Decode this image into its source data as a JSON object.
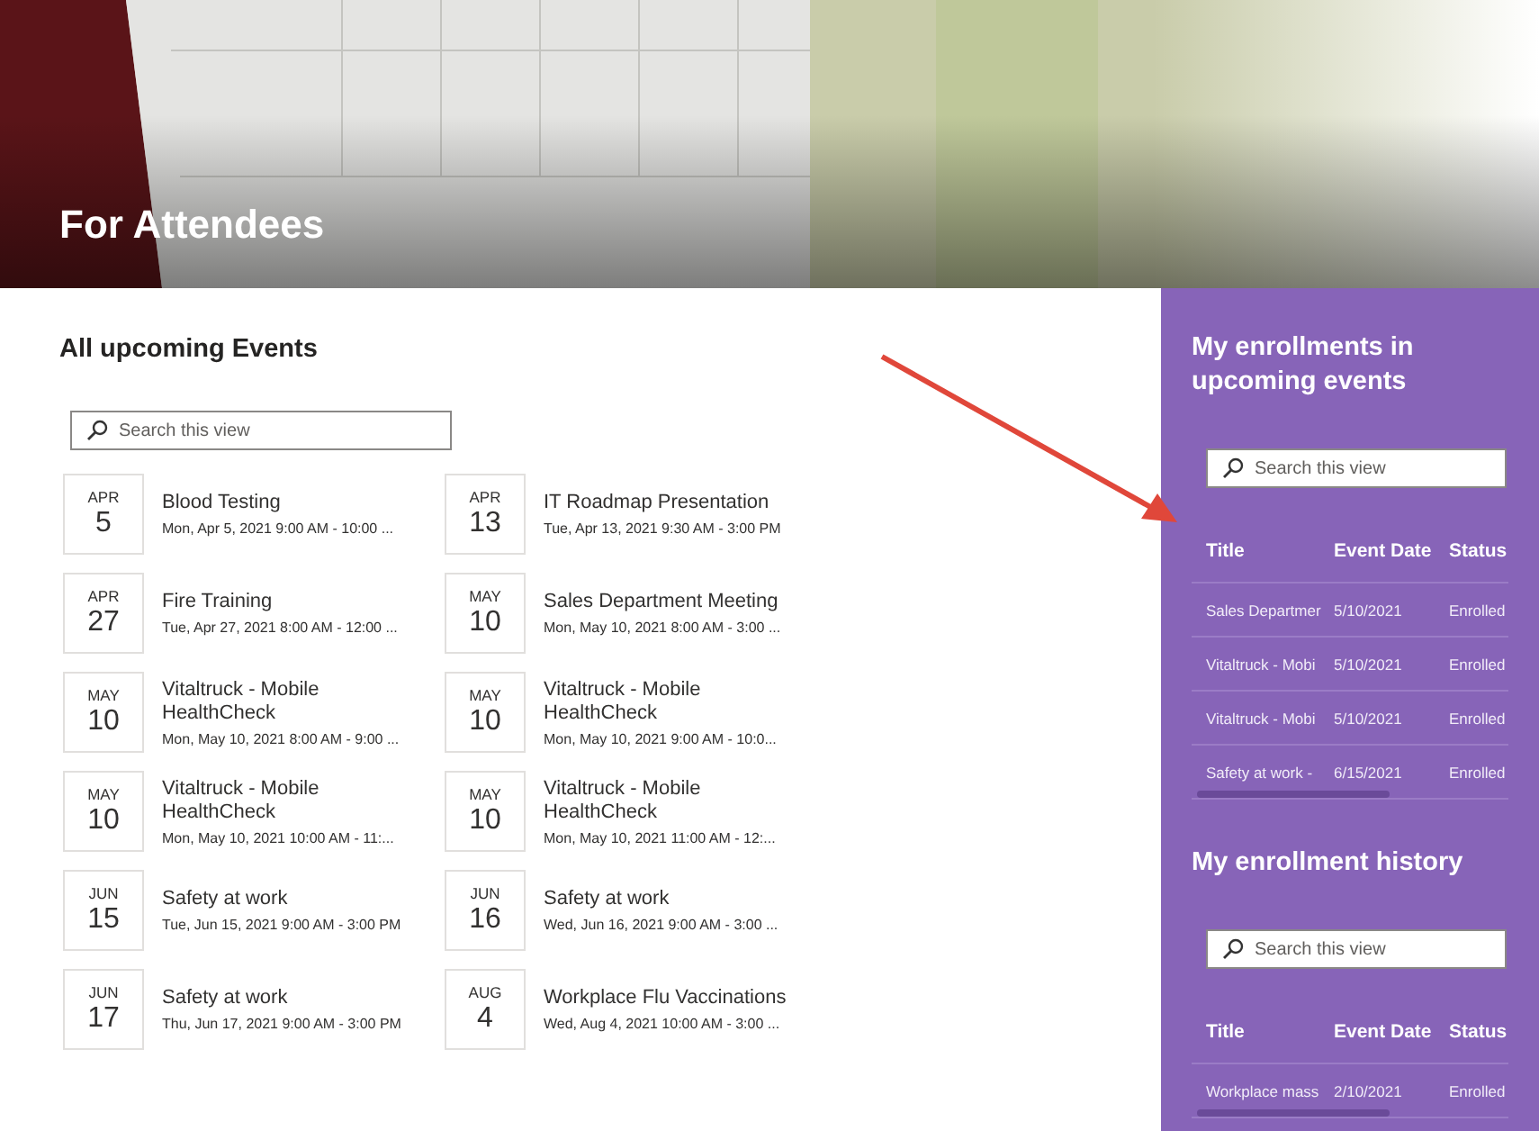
{
  "header": {
    "title": "For Attendees"
  },
  "upcoming": {
    "title": "All upcoming Events",
    "search": {
      "placeholder": "Search this view"
    },
    "events": [
      {
        "month": "APR",
        "day": "5",
        "title": "Blood Testing",
        "time": "Mon, Apr 5, 2021 9:00 AM - 10:00 ..."
      },
      {
        "month": "APR",
        "day": "13",
        "title": "IT Roadmap Presentation",
        "time": "Tue, Apr 13, 2021 9:30 AM - 3:00 PM"
      },
      {
        "month": "APR",
        "day": "27",
        "title": "Fire Training",
        "time": "Tue, Apr 27, 2021 8:00 AM - 12:00 ..."
      },
      {
        "month": "MAY",
        "day": "10",
        "title": "Sales Department Meeting",
        "time": "Mon, May 10, 2021 8:00 AM - 3:00 ..."
      },
      {
        "month": "MAY",
        "day": "10",
        "title": "Vitaltruck - Mobile HealthCheck",
        "time": "Mon, May 10, 2021 8:00 AM - 9:00 ..."
      },
      {
        "month": "MAY",
        "day": "10",
        "title": "Vitaltruck - Mobile HealthCheck",
        "time": "Mon, May 10, 2021 9:00 AM - 10:0..."
      },
      {
        "month": "MAY",
        "day": "10",
        "title": "Vitaltruck - Mobile HealthCheck",
        "time": "Mon, May 10, 2021 10:00 AM - 11:..."
      },
      {
        "month": "MAY",
        "day": "10",
        "title": "Vitaltruck - Mobile HealthCheck",
        "time": "Mon, May 10, 2021 11:00 AM - 12:..."
      },
      {
        "month": "JUN",
        "day": "15",
        "title": "Safety at work",
        "time": "Tue, Jun 15, 2021 9:00 AM - 3:00 PM"
      },
      {
        "month": "JUN",
        "day": "16",
        "title": "Safety at work",
        "time": "Wed, Jun 16, 2021 9:00 AM - 3:00 ..."
      },
      {
        "month": "JUN",
        "day": "17",
        "title": "Safety at work",
        "time": "Thu, Jun 17, 2021 9:00 AM - 3:00 PM"
      },
      {
        "month": "AUG",
        "day": "4",
        "title": "Workplace Flu Vaccinations",
        "time": "Wed, Aug 4, 2021 10:00 AM - 3:00 ..."
      }
    ]
  },
  "enrollments": {
    "title": "My enrollments in upcoming events",
    "search": {
      "placeholder": "Search this view"
    },
    "columns": [
      "Title",
      "Event Date",
      "Status"
    ],
    "rows": [
      [
        "Sales Departmer",
        "5/10/2021",
        "Enrolled"
      ],
      [
        "Vitaltruck - Mobi",
        "5/10/2021",
        "Enrolled"
      ],
      [
        "Vitaltruck - Mobi",
        "5/10/2021",
        "Enrolled"
      ],
      [
        "Safety at work -",
        "6/15/2021",
        "Enrolled"
      ]
    ]
  },
  "history": {
    "title": "My enrollment history",
    "search": {
      "placeholder": "Search this view"
    },
    "columns": [
      "Title",
      "Event Date",
      "Status"
    ],
    "rows": [
      [
        "Workplace mass",
        "2/10/2021",
        "Enrolled"
      ]
    ]
  }
}
